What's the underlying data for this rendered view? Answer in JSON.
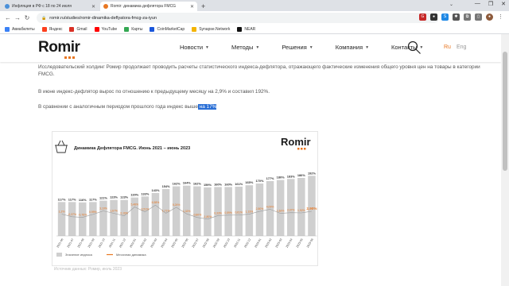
{
  "browser": {
    "tabs": [
      {
        "title": "Инфляция в РФ с 18 по 24 июля",
        "active": false,
        "favicon_color": "#4a90d9"
      },
      {
        "title": "Romir: динамика дефлятора FMCG",
        "active": true,
        "favicon_color": "#e87722"
      }
    ],
    "new_tab": "+",
    "url": "romir.ru/studies/romir-dinamika-deflyatora-fmcg-za-iyun",
    "bookmarks": [
      {
        "label": "Авиабилеты",
        "color": "#3b82f6"
      },
      {
        "label": "Яндекс",
        "color": "#fc3f1d"
      },
      {
        "label": "Gmail",
        "color": "#d93025"
      },
      {
        "label": "YouTube",
        "color": "#ff0000"
      },
      {
        "label": "Карты",
        "color": "#34a853"
      },
      {
        "label": "CoinMarketCap",
        "color": "#1a56db"
      },
      {
        "label": "Synapse.Network",
        "color": "#f4b400"
      },
      {
        "label": "NEAR",
        "color": "#111111"
      }
    ]
  },
  "site": {
    "logo": "Romir",
    "nav": [
      "Новости",
      "Методы",
      "Решения",
      "Компания",
      "Контакты"
    ],
    "lang_ru": "Ru",
    "lang_en": "Eng",
    "accent": "#e87722"
  },
  "article": {
    "p1": "Исследовательский холдинг Ромир продолжает проводить расчеты статистического индекса-дефлятора, отражающего фактические изменения общего уровня цен на товары в категории FMCG.",
    "p2": "В июне индекс-дефлятор вырос по отношению к предыдущему месяцу на 2,9% и составил 192%.",
    "p3_prefix": "В сравнении с аналогичным периодом прошлого года индекс выше",
    "p3_highlight": " на 17%"
  },
  "chart_data": {
    "type": "bar",
    "title": "Динамика Дефлятора FMCG. Июнь 2021 – июнь 2023",
    "logo": "Romir",
    "categories": [
      "2021-06",
      "2021-07",
      "2021-08",
      "2021-09",
      "2021-10",
      "2021-11",
      "2021-12",
      "2022-01",
      "2022-02",
      "2022-03",
      "2022-04",
      "2022-05",
      "2022-06",
      "2022-07",
      "2022-08",
      "2022-09",
      "2022-10",
      "2022-11",
      "2022-12",
      "2023-01",
      "2023-02",
      "2023-03",
      "2023-04",
      "2023-05",
      "2023-06"
    ],
    "series": [
      {
        "name": "Значение индекса",
        "color": "#cfcfcf",
        "values": [
          117,
          117,
          116,
          117,
          121,
          123,
          123,
          130,
          133,
          143,
          154,
          162,
          164,
          162,
          159,
          160,
          160,
          161,
          165,
          170,
          177,
          180,
          183,
          186,
          192
        ],
        "labels": [
          "117%",
          "117%",
          "116%",
          "117%",
          "121%",
          "123%",
          "123%",
          "130%",
          "133%",
          "143%",
          "154%",
          "162%",
          "164%",
          "162%",
          "159%",
          "160%",
          "160%",
          "161%",
          "165%",
          "170%",
          "177%",
          "180%",
          "183%",
          "186%",
          "192%"
        ]
      },
      {
        "name": "Месячная динамика",
        "color": "#e87722",
        "values": [
          1.2,
          -0.37,
          -0.76,
          0.99,
          3.1,
          1.67,
          0.16,
          5.48,
          2.51,
          6.58,
          1.71,
          5.24,
          1.32,
          -0.8,
          -1.8,
          0.33,
          0.59,
          0.61,
          1.13,
          2.8,
          4.09,
          1.62,
          2.07,
          1.92,
          2.9
        ],
        "labels": [
          "1,2%",
          "-0,37%",
          "-0,76%",
          "0,99%",
          "3,10%",
          "1,67%",
          "0,16%",
          "5,48%",
          "2,51%",
          "6,58%",
          "1,71%",
          "5,24%",
          "1,32%",
          "-0,80%",
          "-1,80%",
          "0,33%",
          "0,59%",
          "0,61%",
          "1,13%",
          "2,80%",
          "4,09%",
          "1,62%",
          "2,07%",
          "1,92%",
          "2,90%"
        ]
      }
    ]
  },
  "source": "Источник данных: Ромир, июль 2023"
}
